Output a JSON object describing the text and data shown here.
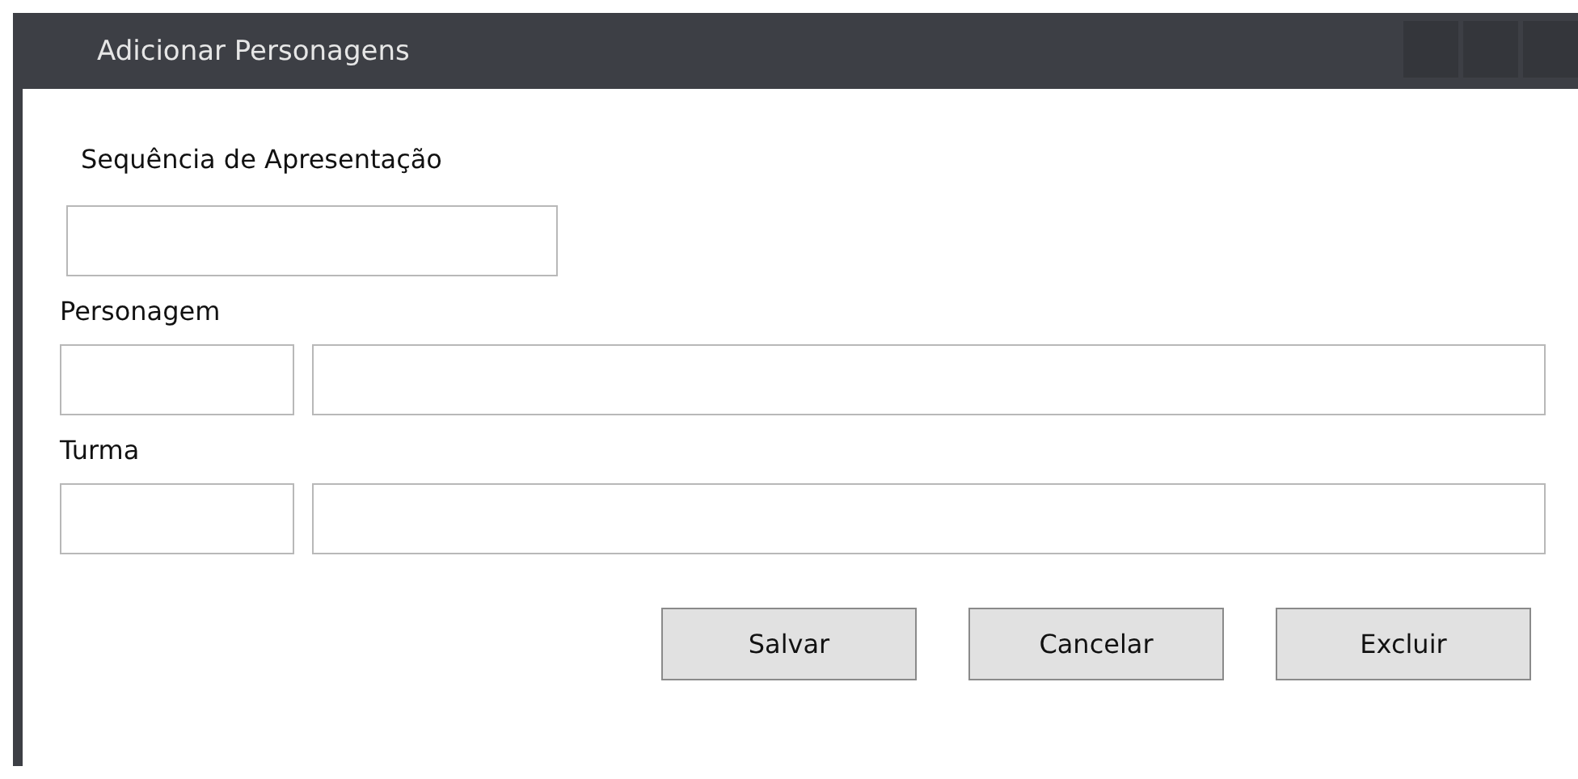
{
  "window": {
    "title": "Adicionar Personagens"
  },
  "fields": [
    {
      "label": "Sequência de Apresentação",
      "kind": "single"
    },
    {
      "label": "Personagem",
      "kind": "pair"
    },
    {
      "label": "Turma",
      "kind": "pair"
    }
  ],
  "buttons": [
    "Salvar",
    "Cancelar",
    "Excluir"
  ]
}
